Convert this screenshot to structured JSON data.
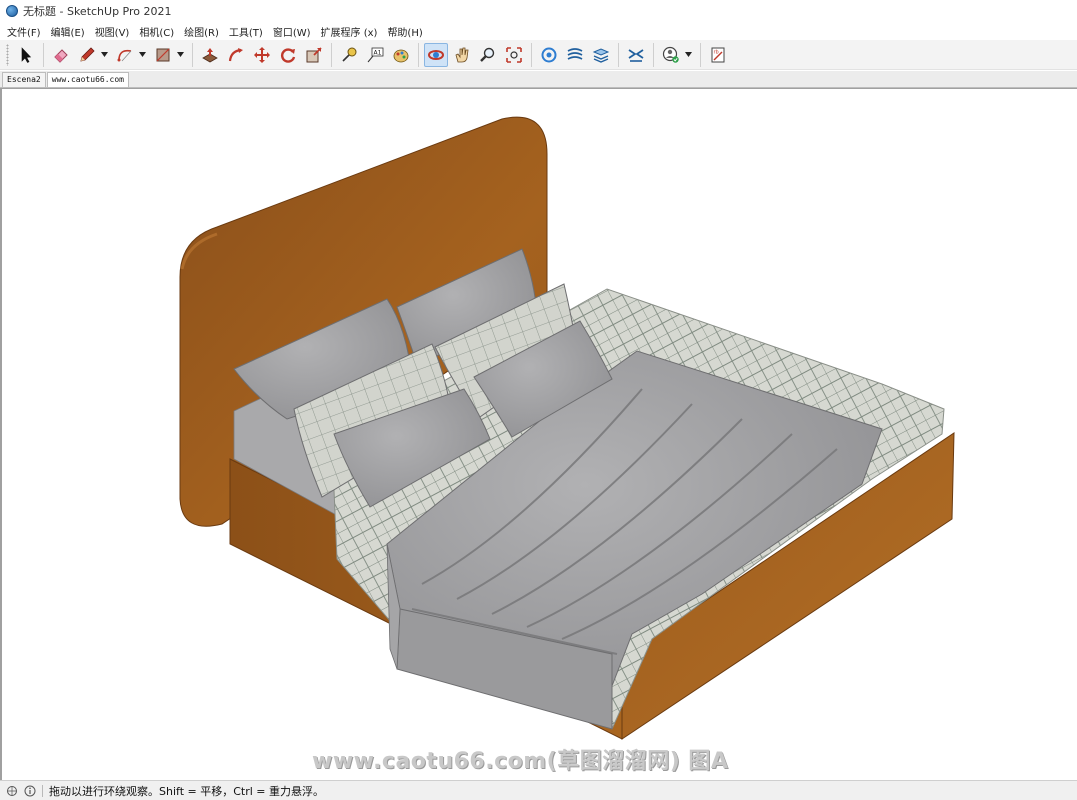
{
  "window": {
    "title": "无标题 - SketchUp Pro 2021"
  },
  "menubar": {
    "items": [
      "文件(F)",
      "编辑(E)",
      "视图(V)",
      "相机(C)",
      "绘图(R)",
      "工具(T)",
      "窗口(W)",
      "扩展程序 (x)",
      "帮助(H)"
    ]
  },
  "toolbar": {
    "tools": [
      "select-icon",
      "eraser-icon",
      "pencil-icon",
      "arc-icon",
      "rectangle-icon",
      "push-pull-icon",
      "follow-me-icon",
      "move-icon",
      "rotate-icon",
      "scale-icon",
      "tape-measure-icon",
      "text-icon",
      "paint-bucket-icon",
      "orbit-icon",
      "pan-icon",
      "zoom-icon",
      "zoom-extents-icon",
      "model-info-icon",
      "sandbox-icon",
      "layers-icon",
      "section-icon",
      "user-account-icon",
      "extension-warehouse-icon"
    ],
    "active_tool": "orbit-icon"
  },
  "scene_tabs": {
    "tabs": [
      "Escena2",
      "www.caotu66.com"
    ],
    "selected": "www.caotu66.com"
  },
  "viewport": {
    "watermark": "www.caotu66.com(草图溜溜网) 图A",
    "colors": {
      "bed_frame": "#a8651f",
      "bedding": "#9a9a9c",
      "plaid": "#d4d6cf"
    }
  },
  "statusbar": {
    "text": "拖动以进行环绕观察。Shift = 平移，Ctrl = 重力悬浮。"
  }
}
